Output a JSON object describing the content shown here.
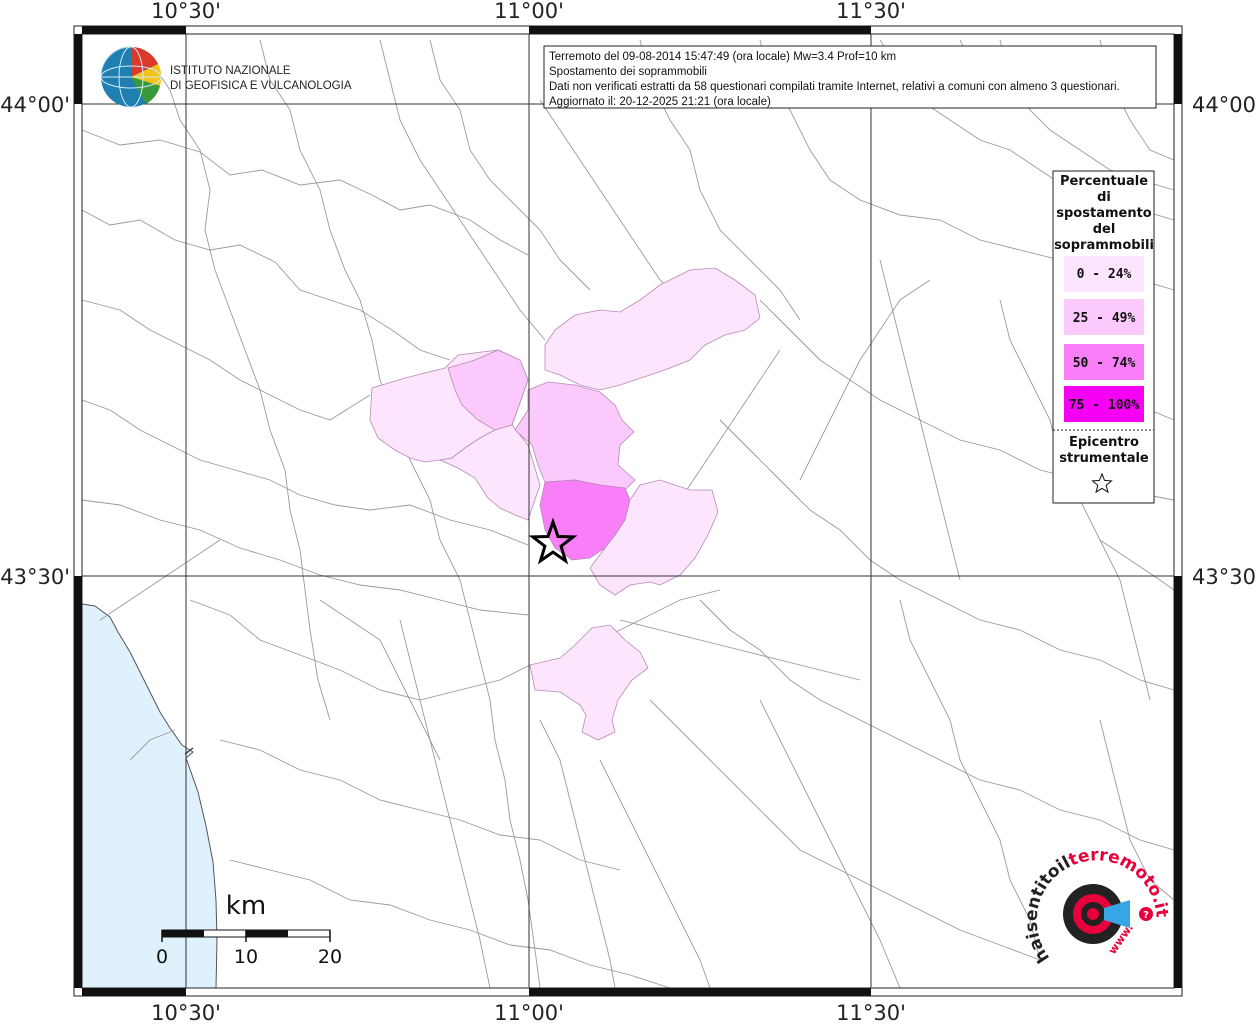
{
  "coords": {
    "top": [
      "10°30'",
      "11°00'",
      "11°30'"
    ],
    "bottom": [
      "10°30'",
      "11°00'",
      "11°30'"
    ],
    "left": [
      "44°00'",
      "43°30'"
    ],
    "right": [
      "44°00'",
      "43°30'"
    ]
  },
  "logo": {
    "line1": "ISTITUTO NAZIONALE",
    "line2": "DI GEOFISICA E VULCANOLOGIA"
  },
  "info": {
    "line1": "Terremoto del 09-08-2014 15:47:49 (ora locale) Mw=3.4 Prof=10 km",
    "line2": "Spostamento dei soprammobili",
    "line3": "Dati non verificati estratti da 58 questionari compilati tramite Internet, relativi a comuni con almeno 3 questionari.",
    "line4": "Aggiornato il: 20-12-2025 21:21 (ora locale)"
  },
  "legend": {
    "title": [
      "Percentuale",
      "di",
      "spostamento",
      "del",
      "soprammobili"
    ],
    "classes": [
      {
        "label": "0 - 24%",
        "color": "#fde6fd"
      },
      {
        "label": "25 - 49%",
        "color": "#fbc9fb"
      },
      {
        "label": "50 - 74%",
        "color": "#f87ff8"
      },
      {
        "label": "75 - 100%",
        "color": "#f500f5"
      }
    ],
    "epicenter_title": [
      "Epicentro",
      "strumentale"
    ]
  },
  "scale": {
    "unit": "km",
    "ticks": [
      "0",
      "10",
      "20"
    ]
  },
  "watermark": {
    "text_part1": "haisentitoil",
    "text_part2": "terremoto.it",
    "text_url": "www.",
    "text_q": "?"
  },
  "colors": {
    "sea": "#dff1fc",
    "border": "#8a8a8a",
    "grid": "#333333"
  }
}
